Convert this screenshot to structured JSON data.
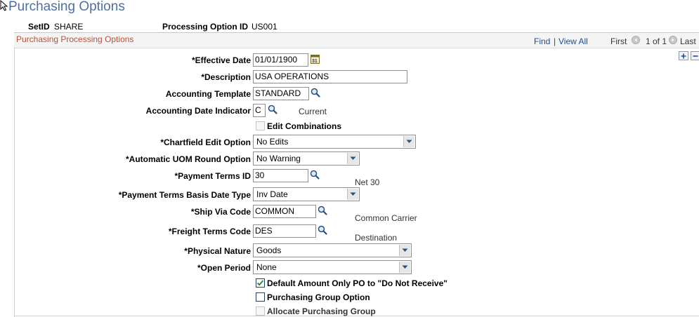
{
  "page": {
    "title": "Purchasing Options"
  },
  "header": {
    "setid_label": "SetID",
    "setid_value": "SHARE",
    "procid_label": "Processing Option ID",
    "procid_value": "US001"
  },
  "section": {
    "title": "Purchasing Processing Options",
    "find": "Find",
    "separator": "|",
    "view_all": "View All",
    "first": "First",
    "count": "1 of 1",
    "last": "Last"
  },
  "fields": {
    "effective_date": {
      "label": "*Effective Date",
      "value": "01/01/1900"
    },
    "description": {
      "label": "*Description",
      "value": "USA OPERATIONS"
    },
    "accounting_template": {
      "label": "Accounting Template",
      "value": "STANDARD"
    },
    "accounting_date_indicator": {
      "label": "Accounting Date Indicator",
      "value": "C",
      "desc": "Current"
    },
    "edit_combinations": {
      "label": "Edit Combinations",
      "checked": false,
      "disabled": true
    },
    "chartfield_edit_option": {
      "label": "*Chartfield Edit Option",
      "value": "No Edits"
    },
    "auto_uom_round": {
      "label": "*Automatic UOM Round Option",
      "value": "No Warning"
    },
    "payment_terms_id": {
      "label": "*Payment Terms ID",
      "value": "30",
      "desc": "Net 30"
    },
    "payment_terms_basis": {
      "label": "*Payment Terms Basis Date Type",
      "value": "Inv Date"
    },
    "ship_via_code": {
      "label": "*Ship Via Code",
      "value": "COMMON",
      "desc": "Common Carrier"
    },
    "freight_terms_code": {
      "label": "*Freight Terms Code",
      "value": "DES",
      "desc": "Destination"
    },
    "physical_nature": {
      "label": "*Physical Nature",
      "value": "Goods"
    },
    "open_period": {
      "label": "*Open Period",
      "value": "None"
    },
    "default_amount_only": {
      "label": "Default Amount Only PO to \"Do Not Receive\"",
      "checked": true
    },
    "purchasing_group_option": {
      "label": "Purchasing Group Option",
      "checked": false
    },
    "allocate_purchasing_group": {
      "label": "Allocate Purchasing Group",
      "checked": false,
      "disabled": true
    }
  },
  "colors": {
    "title": "#4d6fa1",
    "section_title": "#b7523a",
    "link": "#1f4d90",
    "check": "#2f8f2f"
  },
  "icons": [
    "mouse-cursor-icon",
    "calendar-icon",
    "lookup-icon",
    "dropdown-arrow-icon",
    "previous-icon",
    "next-icon",
    "add-row-icon",
    "delete-row-icon",
    "checkmark-icon"
  ]
}
